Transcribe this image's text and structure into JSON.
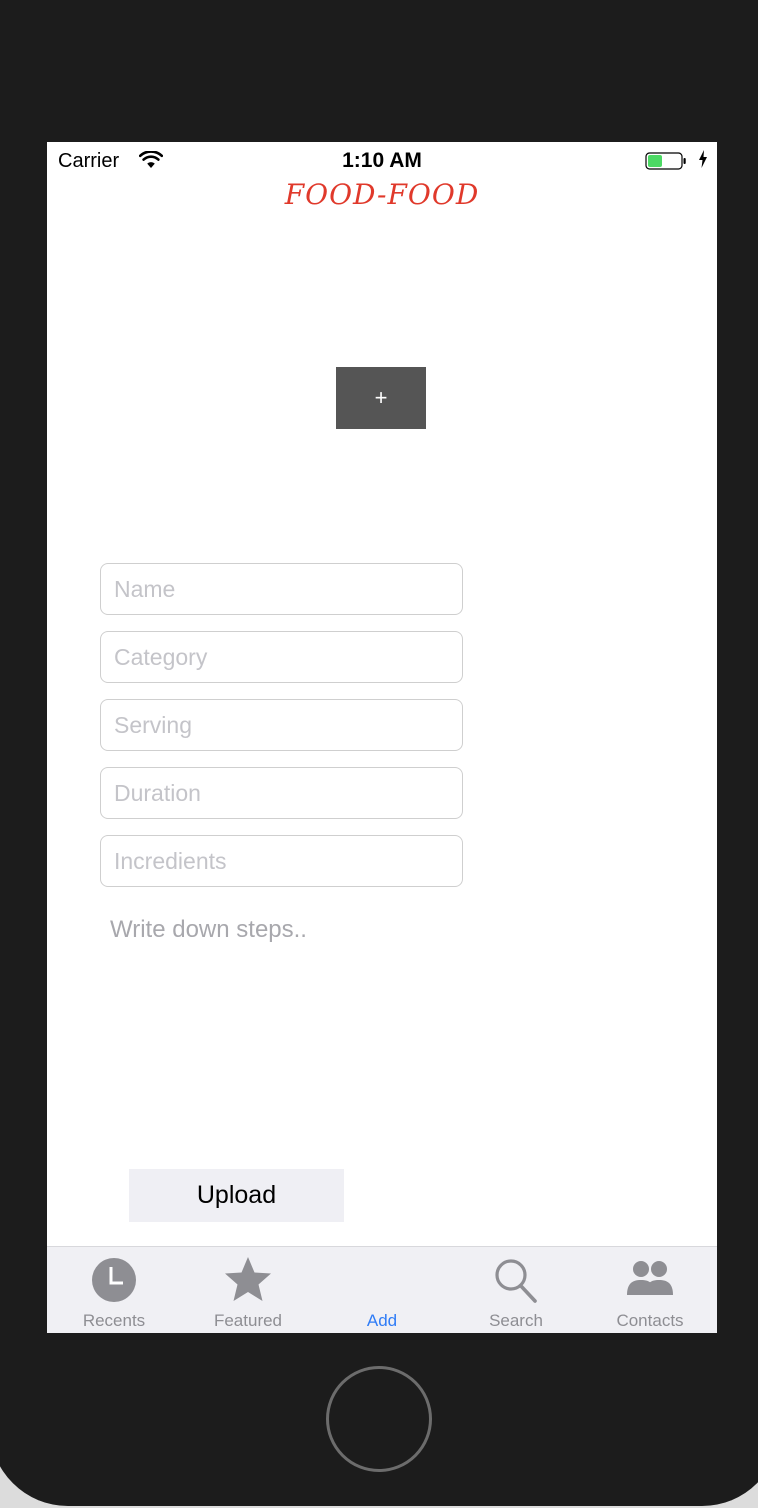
{
  "status_bar": {
    "carrier": "Carrier",
    "time": "1:10 AM",
    "battery_color": "#4cd964"
  },
  "app": {
    "title": "FOOD-FOOD",
    "title_color": "#e0392b"
  },
  "add_photo_button": {
    "label": "+",
    "icon": "plus-icon"
  },
  "form": {
    "name_placeholder": "Name",
    "category_placeholder": "Category",
    "serving_placeholder": "Serving",
    "duration_placeholder": "Duration",
    "ingredients_placeholder": "Incredients",
    "steps_placeholder": "Write down steps.."
  },
  "upload_button": {
    "label": "Upload"
  },
  "tab_bar": {
    "active_color": "#2f7cf6",
    "items": [
      {
        "label": "Recents",
        "icon": "clock-icon"
      },
      {
        "label": "Featured",
        "icon": "star-icon"
      },
      {
        "label": "Add",
        "icon": "",
        "active": true
      },
      {
        "label": "Search",
        "icon": "search-icon"
      },
      {
        "label": "Contacts",
        "icon": "contacts-icon"
      }
    ]
  }
}
